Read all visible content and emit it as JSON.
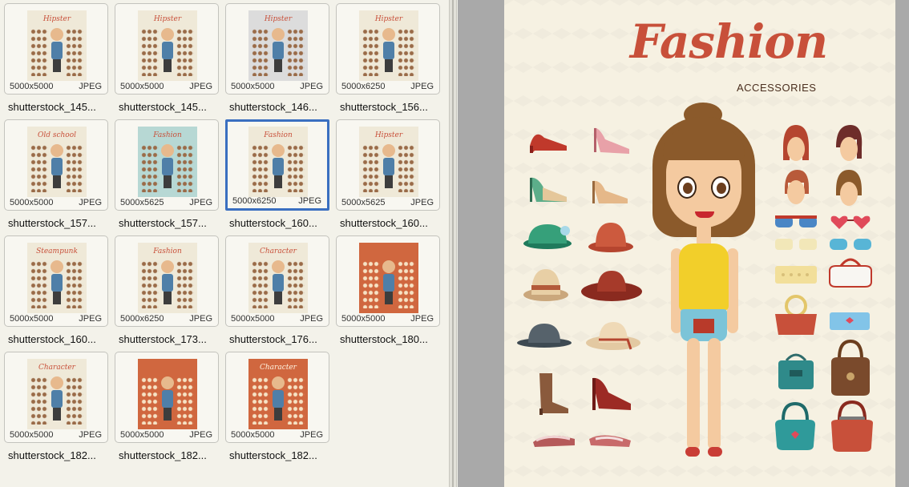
{
  "thumbnails": [
    {
      "name": "shutterstock_145...",
      "dim": "5000x5000",
      "fmt": "JPEG",
      "title": "Hipster",
      "theme": "cream",
      "selected": false
    },
    {
      "name": "shutterstock_145...",
      "dim": "5000x5000",
      "fmt": "JPEG",
      "title": "Hipster",
      "theme": "cream",
      "selected": false
    },
    {
      "name": "shutterstock_146...",
      "dim": "5000x5000",
      "fmt": "JPEG",
      "title": "Hipster",
      "theme": "grey",
      "selected": false
    },
    {
      "name": "shutterstock_156...",
      "dim": "5000x6250",
      "fmt": "JPEG",
      "title": "Hipster",
      "theme": "cream",
      "selected": false
    },
    {
      "name": "shutterstock_157...",
      "dim": "5000x5000",
      "fmt": "JPEG",
      "title": "Old school",
      "theme": "cream",
      "selected": false
    },
    {
      "name": "shutterstock_157...",
      "dim": "5000x5625",
      "fmt": "JPEG",
      "title": "Fashion",
      "theme": "teal",
      "selected": false
    },
    {
      "name": "shutterstock_160...",
      "dim": "5000x6250",
      "fmt": "JPEG",
      "title": "Fashion",
      "theme": "cream",
      "selected": true
    },
    {
      "name": "shutterstock_160...",
      "dim": "5000x5625",
      "fmt": "JPEG",
      "title": "Hipster",
      "theme": "cream",
      "selected": false
    },
    {
      "name": "shutterstock_160...",
      "dim": "5000x5000",
      "fmt": "JPEG",
      "title": "Steampunk",
      "theme": "cream",
      "selected": false
    },
    {
      "name": "shutterstock_173...",
      "dim": "5000x6250",
      "fmt": "JPEG",
      "title": "Fashion",
      "theme": "cream",
      "selected": false
    },
    {
      "name": "shutterstock_176...",
      "dim": "5000x5000",
      "fmt": "JPEG",
      "title": "Character",
      "theme": "cream",
      "selected": false
    },
    {
      "name": "shutterstock_180...",
      "dim": "5000x5000",
      "fmt": "JPEG",
      "title": "",
      "theme": "rust",
      "selected": false
    },
    {
      "name": "shutterstock_182...",
      "dim": "5000x5000",
      "fmt": "JPEG",
      "title": "Character",
      "theme": "cream",
      "selected": false
    },
    {
      "name": "shutterstock_182...",
      "dim": "5000x5000",
      "fmt": "JPEG",
      "title": "",
      "theme": "rust",
      "selected": false
    },
    {
      "name": "shutterstock_182...",
      "dim": "5000x5000",
      "fmt": "JPEG",
      "title": "Character",
      "theme": "rust",
      "selected": false
    }
  ],
  "preview": {
    "title": "Fashion",
    "subtitle": "ACCESSORIES"
  },
  "colors": {
    "selection": "#3a6fc0",
    "poster_bg": "#f6f1e2",
    "title_red": "#c8503a"
  }
}
